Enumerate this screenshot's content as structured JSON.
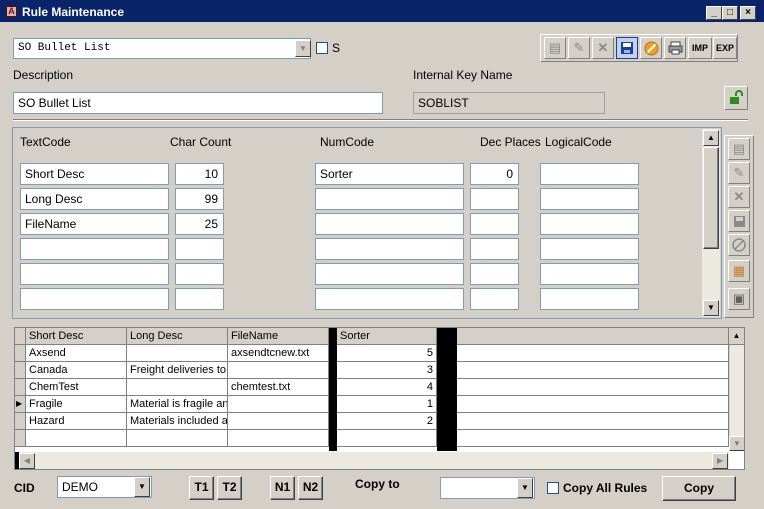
{
  "window": {
    "title": "Rule Maintenance",
    "app_icon_glyph": "A",
    "minimize_glyph": "_",
    "maximize_glyph": "□",
    "close_glyph": "×"
  },
  "header": {
    "rule_select_value": "SO Bullet List",
    "s_checkbox_label": "S",
    "description_label": "Description",
    "description_value": "SO Bullet List",
    "internal_key_label": "Internal Key Name",
    "internal_key_value": "SOBLIST"
  },
  "toolbar": {
    "import_label": "IMP",
    "export_label": "EXP"
  },
  "fields": {
    "textcode_header": "TextCode",
    "charcount_header": "Char Count",
    "numcode_header": "NumCode",
    "decplaces_header": "Dec Places",
    "logicalcode_header": "LogicalCode",
    "rows": [
      {
        "textcode": "Short Desc",
        "charcount": "10",
        "numcode": "Sorter",
        "decplaces": "0",
        "logical": ""
      },
      {
        "textcode": "Long Desc",
        "charcount": "99",
        "numcode": "",
        "decplaces": "",
        "logical": ""
      },
      {
        "textcode": "FileName",
        "charcount": "25",
        "numcode": "",
        "decplaces": "",
        "logical": ""
      },
      {
        "textcode": "",
        "charcount": "",
        "numcode": "",
        "decplaces": "",
        "logical": ""
      },
      {
        "textcode": "",
        "charcount": "",
        "numcode": "",
        "decplaces": "",
        "logical": ""
      },
      {
        "textcode": "",
        "charcount": "",
        "numcode": "",
        "decplaces": "",
        "logical": ""
      }
    ]
  },
  "grid": {
    "columns": [
      "Short Desc",
      "Long Desc",
      "FileName",
      "Sorter"
    ],
    "rows": [
      {
        "short": "Axsend",
        "long": "",
        "file": "axsendtcnew.txt",
        "sorter": "5",
        "current": false
      },
      {
        "short": "Canada",
        "long": "Freight deliveries to C",
        "file": "",
        "sorter": "3",
        "current": false
      },
      {
        "short": "ChemTest",
        "long": "",
        "file": "chemtest.txt",
        "sorter": "4",
        "current": false
      },
      {
        "short": "Fragile",
        "long": "Material is fragile and",
        "file": "",
        "sorter": "1",
        "current": true
      },
      {
        "short": "Hazard",
        "long": "Materials included ar",
        "file": "",
        "sorter": "2",
        "current": false
      },
      {
        "short": "",
        "long": "",
        "file": "",
        "sorter": "",
        "current": false
      }
    ]
  },
  "footer": {
    "cid_label": "CID",
    "cid_value": "DEMO",
    "t1_label": "T1",
    "t2_label": "T2",
    "n1_label": "N1",
    "n2_label": "N2",
    "copy_to_label": "Copy to",
    "copy_to_value": "",
    "copy_all_label": "Copy All Rules",
    "copy_button_label": "Copy"
  },
  "colors": {
    "title_bar": "#0a246a",
    "field_border": "#7f9db9",
    "readonly_field": "#d4d0c8",
    "lock_icon": "#2e8b1f",
    "save_icon": "#1d3f9c",
    "cancel_icon": "#f0a020"
  }
}
